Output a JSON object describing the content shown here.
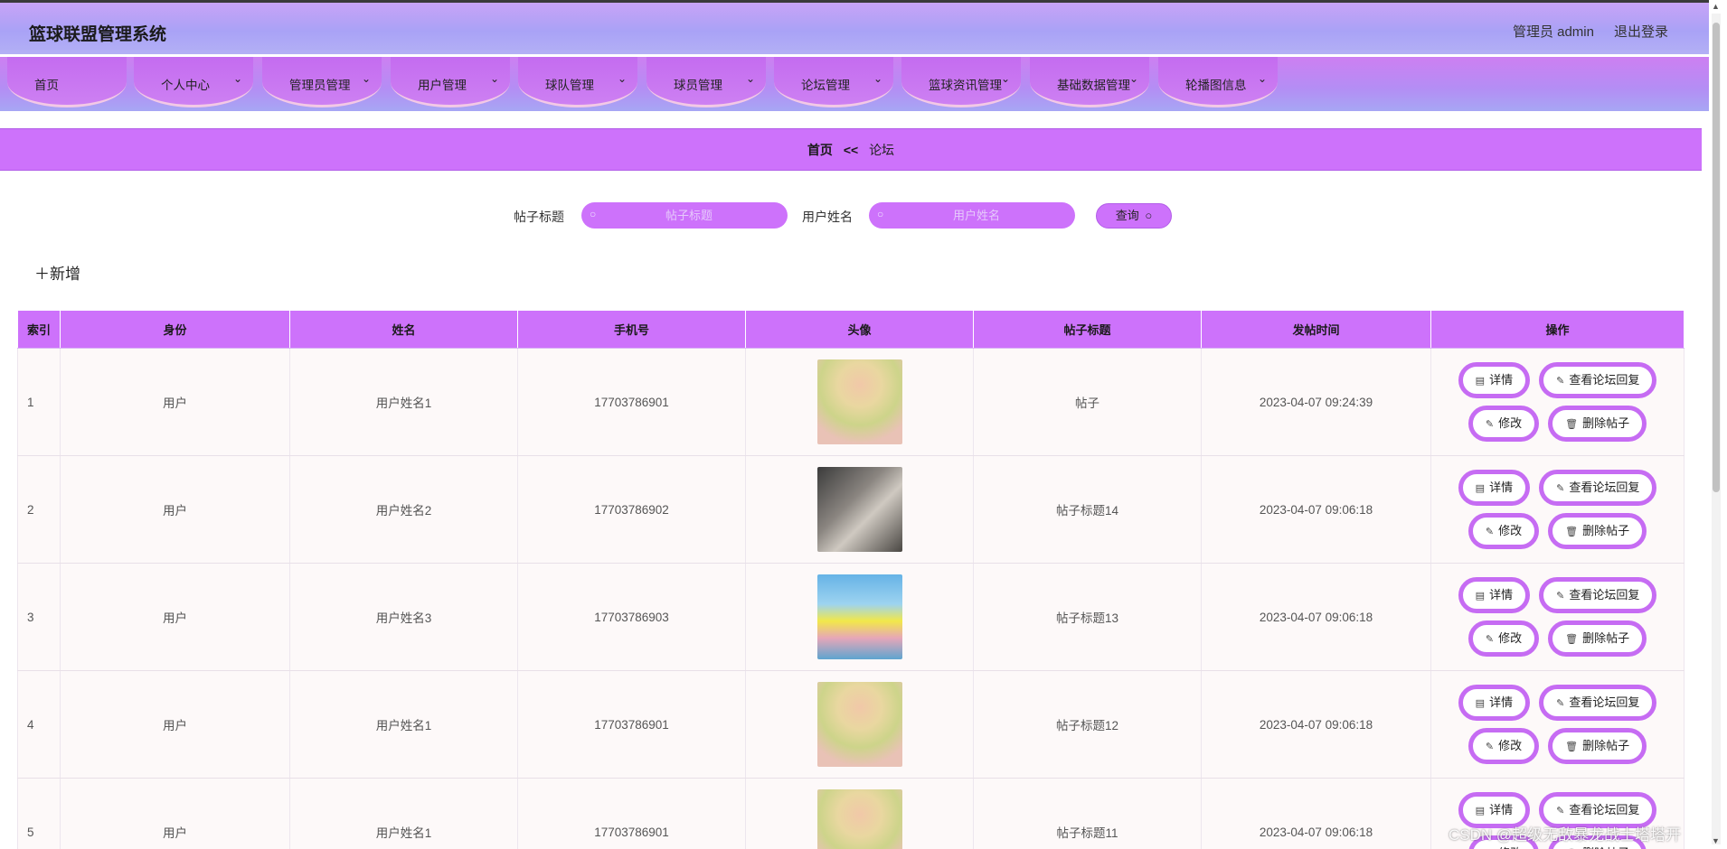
{
  "header": {
    "title": "篮球联盟管理系统",
    "user": "管理员 admin",
    "logout": "退出登录"
  },
  "nav": [
    {
      "label": "首页",
      "has_menu": false
    },
    {
      "label": "个人中心",
      "has_menu": true
    },
    {
      "label": "管理员管理",
      "has_menu": true
    },
    {
      "label": "用户管理",
      "has_menu": true
    },
    {
      "label": "球队管理",
      "has_menu": true
    },
    {
      "label": "球员管理",
      "has_menu": true
    },
    {
      "label": "论坛管理",
      "has_menu": true
    },
    {
      "label": "篮球资讯管理",
      "has_menu": true
    },
    {
      "label": "基础数据管理",
      "has_menu": true
    },
    {
      "label": "轮播图信息",
      "has_menu": true
    }
  ],
  "breadcrumb": {
    "home": "首页",
    "separator": "<<",
    "current": "论坛"
  },
  "search": {
    "title_label": "帖子标题",
    "title_placeholder": "帖子标题",
    "title_value": "",
    "name_label": "用户姓名",
    "name_placeholder": "用户姓名",
    "name_value": "",
    "query_label": "查询"
  },
  "add_label": "新增",
  "table": {
    "columns": [
      "索引",
      "身份",
      "姓名",
      "手机号",
      "头像",
      "帖子标题",
      "发帖时间",
      "操作"
    ],
    "rows": [
      {
        "index": "1",
        "role": "用户",
        "name": "用户姓名1",
        "phone": "17703786901",
        "avatar": "anime-girl",
        "title": "帖子",
        "time": "2023-04-07 09:24:39"
      },
      {
        "index": "2",
        "role": "用户",
        "name": "用户姓名2",
        "phone": "17703786902",
        "avatar": "man-portrait",
        "title": "帖子标题14",
        "time": "2023-04-07 09:06:18"
      },
      {
        "index": "3",
        "role": "用户",
        "name": "用户姓名3",
        "phone": "17703786903",
        "avatar": "girl-beach",
        "title": "帖子标题13",
        "time": "2023-04-07 09:06:18"
      },
      {
        "index": "4",
        "role": "用户",
        "name": "用户姓名1",
        "phone": "17703786901",
        "avatar": "anime-girl",
        "title": "帖子标题12",
        "time": "2023-04-07 09:06:18"
      },
      {
        "index": "5",
        "role": "用户",
        "name": "用户姓名1",
        "phone": "17703786901",
        "avatar": "anime-girl",
        "title": "帖子标题11",
        "time": "2023-04-07 09:06:18"
      }
    ],
    "actions": {
      "detail": "详情",
      "view_replies": "查看论坛回复",
      "edit": "修改",
      "delete": "删除帖子"
    }
  },
  "watermark": "CSDN @超级无敌暴龙战士塔塔开",
  "colors": {
    "accent": "#cd72fb",
    "button_border": "#c66cf3",
    "header_gradient_top": "#c8a3f7"
  }
}
